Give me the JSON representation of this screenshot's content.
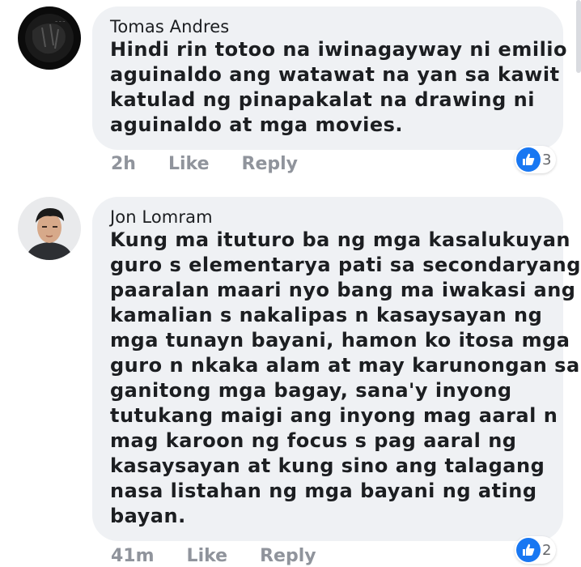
{
  "comments": [
    {
      "author": "Tomas Andres",
      "lines": [
        "Hindi rin totoo na iwinagayway ni emilio",
        "aguinaldo ang watawat na yan sa kawit",
        "katulad ng pinapakalat na drawing ni",
        "aguinaldo at mga movies."
      ],
      "time": "2h",
      "like_label": "Like",
      "reply_label": "Reply",
      "reaction_count": "3",
      "reaction_icon": "thumbs-up-icon",
      "reaction_color": "#1877f2"
    },
    {
      "author": "Jon Lomram",
      "lines": [
        "Kung ma ituturo ba ng mga kasalukuyan",
        "guro s elementarya pati sa secondaryang",
        "paaralan maari nyo bang ma iwakasi ang",
        "kamalian s nakalipas n kasaysayan ng",
        "mga tunayn bayani, hamon ko itosa mga",
        "guro n nkaka alam at may karunongan sa",
        "ganitong mga bagay,  sana'y inyong",
        "tutukang maigi ang inyong mag aaral n",
        "mag karoon ng focus s pag aaral ng",
        "kasaysayan at kung sino ang talagang",
        "nasa listahan ng mga bayani ng ating",
        "bayan."
      ],
      "time": "41m",
      "like_label": "Like",
      "reply_label": "Reply",
      "reaction_count": "2",
      "reaction_icon": "thumbs-up-icon",
      "reaction_color": "#1877f2"
    }
  ],
  "colors": {
    "bubble": "#eff1f4",
    "text": "#1c1e21",
    "muted": "#90949c"
  }
}
